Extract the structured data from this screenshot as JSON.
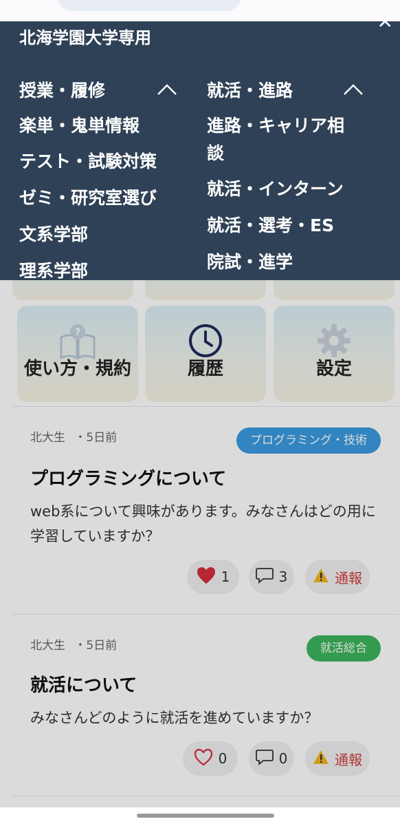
{
  "menu": {
    "title": "北海学園大学専用",
    "close_icon": "close-icon",
    "columns": [
      {
        "heading": "授業・履修",
        "items": [
          "楽単・鬼単情報",
          "テスト・試験対策",
          "ゼミ・研究室選び",
          "文系学部",
          "理系学部"
        ]
      },
      {
        "heading": "就活・進路",
        "items": [
          "進路・キャリア相",
          "談",
          "就活・インターン",
          "就活・選考・ES",
          "院試・進学"
        ]
      }
    ]
  },
  "tiles": [
    {
      "label": "使い方・規約",
      "icon": "book-question-icon"
    },
    {
      "label": "履歴",
      "icon": "clock-icon"
    },
    {
      "label": "設定",
      "icon": "gear-icon"
    }
  ],
  "posts": [
    {
      "author": "北大生",
      "time": "・5日前",
      "tag": "プログラミング・技術",
      "tag_color": "#3b9be0",
      "title": "プログラミングについて",
      "body": "web系について興味があります。みなさんはどの用に学習していますか？",
      "likes": "1",
      "comments": "3",
      "report": "通報",
      "liked": true
    },
    {
      "author": "北大生",
      "time": "・5日前",
      "tag": "就活総合",
      "tag_color": "#3cb55a",
      "title": "就活について",
      "body": "みなさんどのように就活を進めていますか？",
      "likes": "0",
      "comments": "0",
      "report": "通報",
      "liked": false
    }
  ],
  "colors": {
    "menu_bg": "#2f4156",
    "like_red": "#d42d3c",
    "report_red": "#d23b3b"
  }
}
